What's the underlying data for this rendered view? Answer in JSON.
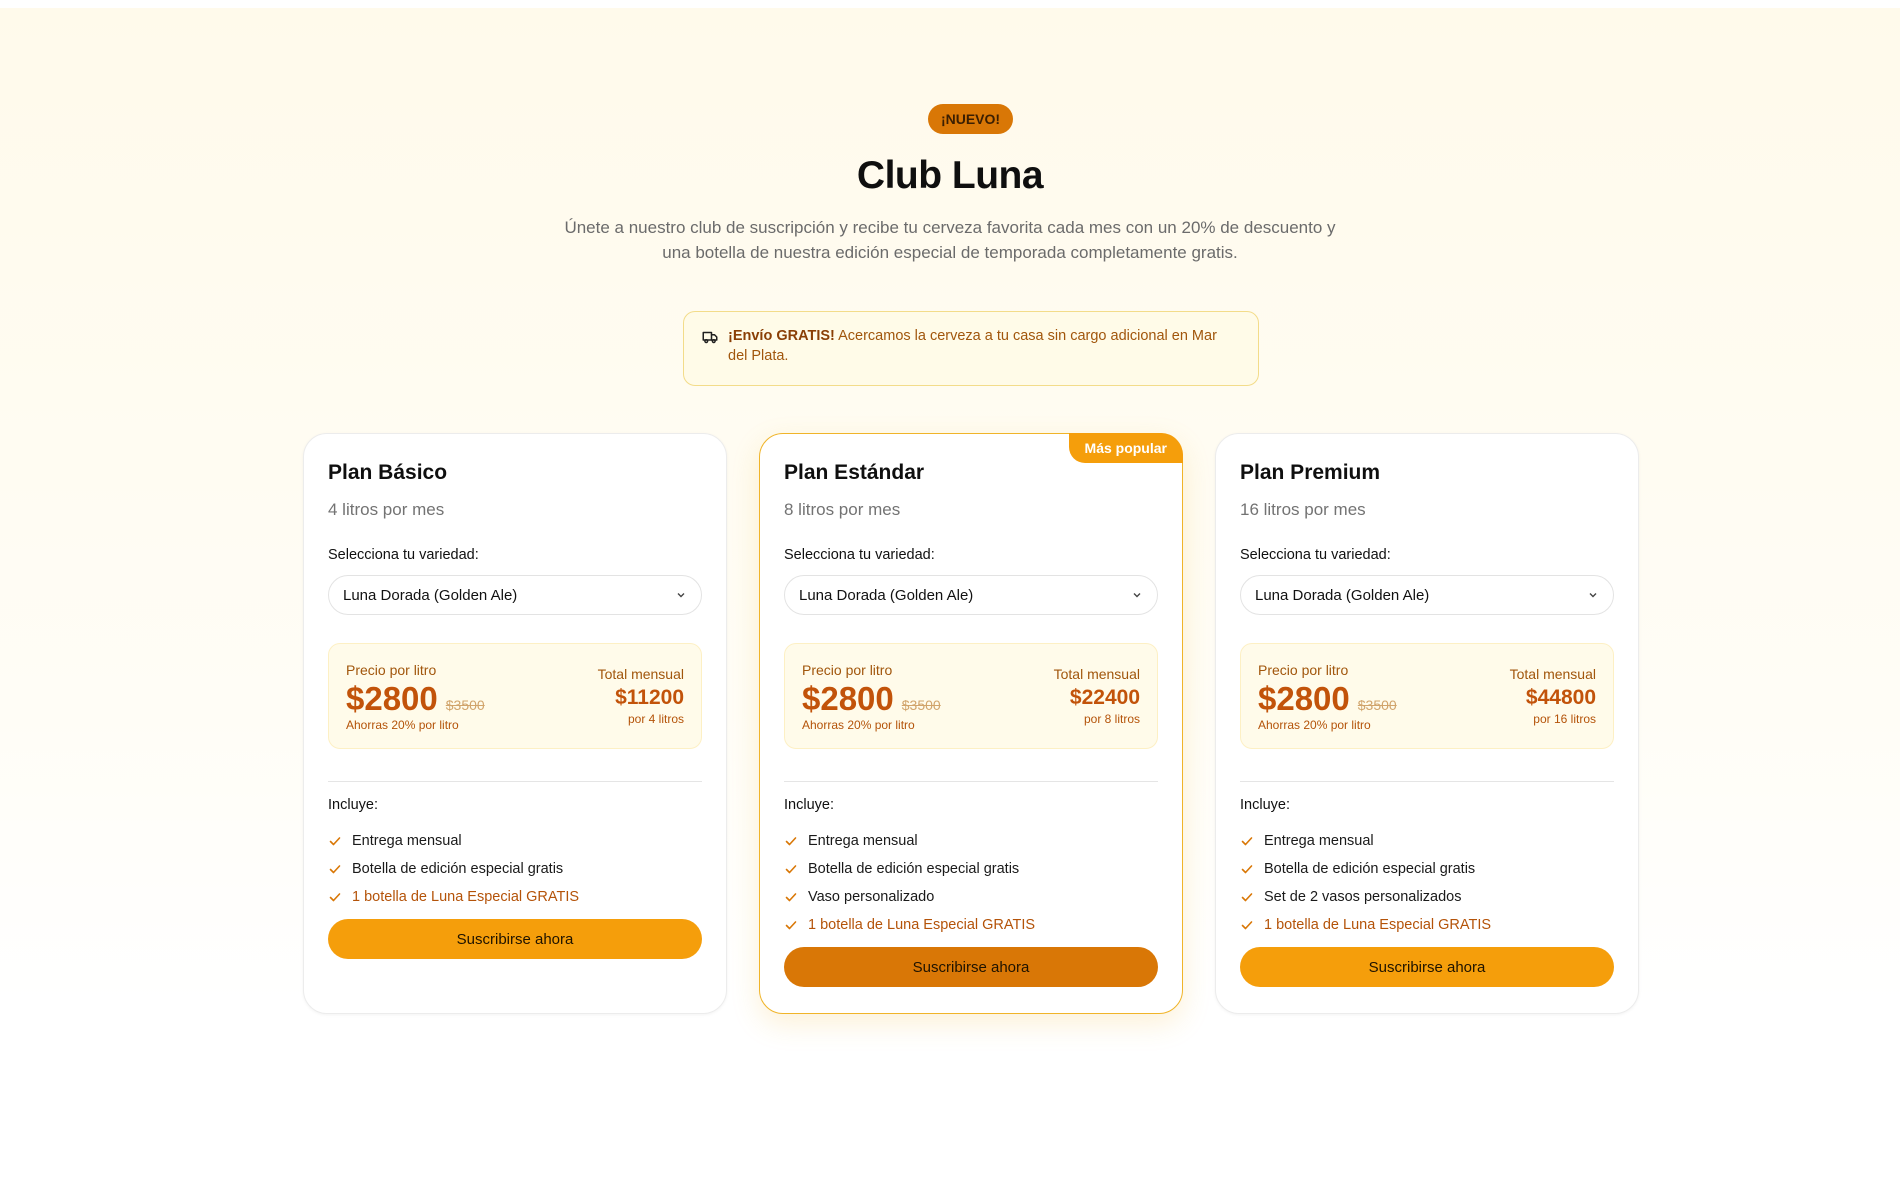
{
  "header": {
    "badge": "¡NUEVO!",
    "title": "Club Luna",
    "subtitle": "Únete a nuestro club de suscripción y recibe tu cerveza favorita cada mes con un 20% de descuento y una botella de nuestra edición especial de temporada completamente gratis."
  },
  "shipping": {
    "icon": "truck-icon",
    "strong": "¡Envío GRATIS!",
    "text": "Acercamos la cerveza a tu casa sin cargo adicional en Mar del Plata."
  },
  "colors": {
    "accent": "#f59e0b",
    "accent_dark": "#d97706",
    "price": "#c2530a"
  },
  "plans": [
    {
      "name": "Plan Básico",
      "liters": "4 litros por mes",
      "variety_label": "Selecciona tu variedad:",
      "variety_selected": "Luna Dorada (Golden Ale)",
      "price_label": "Precio por litro",
      "price": "$2800",
      "old_price": "$3500",
      "saving": "Ahorras 20% por litro",
      "total_label": "Total mensual",
      "total": "$11200",
      "total_sub": "por 4 litros",
      "includes_label": "Incluye:",
      "features": [
        "Entrega mensual",
        "Botella de edición especial gratis",
        "1 botella de Luna Especial GRATIS"
      ],
      "cta": "Suscribirse ahora"
    },
    {
      "name": "Plan Estándar",
      "popular": "Más popular",
      "liters": "8 litros por mes",
      "variety_label": "Selecciona tu variedad:",
      "variety_selected": "Luna Dorada (Golden Ale)",
      "price_label": "Precio por litro",
      "price": "$2800",
      "old_price": "$3500",
      "saving": "Ahorras 20% por litro",
      "total_label": "Total mensual",
      "total": "$22400",
      "total_sub": "por 8 litros",
      "includes_label": "Incluye:",
      "features": [
        "Entrega mensual",
        "Botella de edición especial gratis",
        "Vaso personalizado",
        "1 botella de Luna Especial GRATIS"
      ],
      "cta": "Suscribirse ahora"
    },
    {
      "name": "Plan Premium",
      "liters": "16 litros por mes",
      "variety_label": "Selecciona tu variedad:",
      "variety_selected": "Luna Dorada (Golden Ale)",
      "price_label": "Precio por litro",
      "price": "$2800",
      "old_price": "$3500",
      "saving": "Ahorras 20% por litro",
      "total_label": "Total mensual",
      "total": "$44800",
      "total_sub": "por 16 litros",
      "includes_label": "Incluye:",
      "features": [
        "Entrega mensual",
        "Botella de edición especial gratis",
        "Set de 2 vasos personalizados",
        "1 botella de Luna Especial GRATIS"
      ],
      "cta": "Suscribirse ahora"
    }
  ]
}
